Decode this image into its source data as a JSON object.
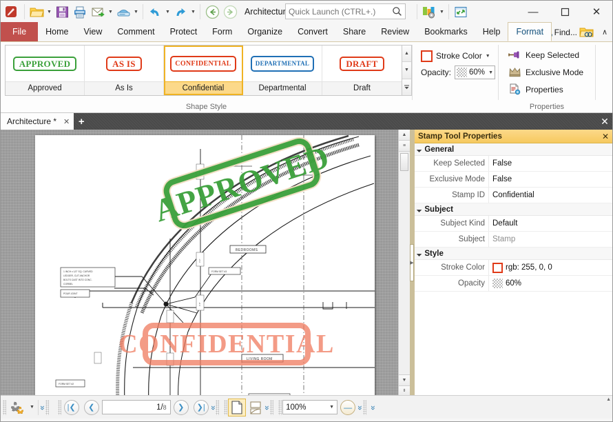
{
  "window": {
    "title": "Architecture* - PDF-XChan..",
    "minimize_label": "—",
    "maximize_label": "☐",
    "close_label": "✕"
  },
  "quick_access": {
    "items": [
      {
        "name": "app-logo",
        "label": "PDF-XChange Editor"
      },
      {
        "name": "open-button",
        "label": "Open",
        "has_dropdown": true
      },
      {
        "name": "save-button",
        "label": "Save",
        "has_dropdown": false
      },
      {
        "name": "print-button",
        "label": "Print",
        "has_dropdown": false
      },
      {
        "name": "email-button",
        "label": "Email",
        "has_dropdown": true
      },
      {
        "name": "scan-button",
        "label": "Scan",
        "has_dropdown": true
      },
      {
        "name": "undo-button",
        "label": "Undo",
        "has_dropdown": true
      },
      {
        "name": "redo-button",
        "label": "Redo",
        "has_dropdown": true
      },
      {
        "name": "back-button",
        "label": "Back",
        "has_dropdown": false
      },
      {
        "name": "forward-button",
        "label": "Forward",
        "has_dropdown": false
      }
    ],
    "customize_label": "Customize Quick Access Toolbar",
    "fullscreen_label": "Full Screen"
  },
  "search": {
    "placeholder": "Quick Launch (CTRL+.)",
    "value": "",
    "icon": "search-icon"
  },
  "ribbon": {
    "tabs": [
      {
        "label": "File",
        "kind": "file"
      },
      {
        "label": "Home"
      },
      {
        "label": "View"
      },
      {
        "label": "Comment"
      },
      {
        "label": "Protect"
      },
      {
        "label": "Form"
      },
      {
        "label": "Organize"
      },
      {
        "label": "Convert"
      },
      {
        "label": "Share"
      },
      {
        "label": "Review"
      },
      {
        "label": "Bookmarks"
      },
      {
        "label": "Help"
      },
      {
        "label": "Format",
        "active": true
      }
    ],
    "find_label": "Find...",
    "collapse_label": "∧"
  },
  "shape_style": {
    "group_label": "Shape Style",
    "items": [
      {
        "caption": "Approved",
        "stamp_text": "APPROVED",
        "color": "#3aa03a",
        "selected": false
      },
      {
        "caption": "As Is",
        "stamp_text": "AS IS",
        "color": "#e03a18",
        "selected": false
      },
      {
        "caption": "Confidential",
        "stamp_text": "CONFIDENTIAL",
        "color": "#e03a18",
        "selected": true
      },
      {
        "caption": "Departmental",
        "stamp_text": "DEPARTMENTAL",
        "color": "#1f6fb5",
        "selected": false
      },
      {
        "caption": "Draft",
        "stamp_text": "DRAFT",
        "color": "#e03a18",
        "selected": false
      }
    ],
    "scroll_up_label": "▲",
    "scroll_down_label": "▼",
    "more_label": "▼"
  },
  "stroke_group": {
    "stroke_color_label": "Stroke Color",
    "stroke_color_hex": "#ff0000",
    "opacity_label": "Opacity:",
    "opacity_value": "60%"
  },
  "properties_group": {
    "group_label": "Properties",
    "items": [
      {
        "label": "Keep Selected",
        "icon": "pin-icon"
      },
      {
        "label": "Exclusive Mode",
        "icon": "crown-icon"
      },
      {
        "label": "Properties",
        "icon": "properties-icon"
      }
    ]
  },
  "doc_tabs": {
    "tabs": [
      {
        "label": "Architecture *",
        "close": "✕"
      }
    ],
    "new_tab_label": "+",
    "close_all_label": "✕"
  },
  "stamp_panel": {
    "title": "Stamp Tool Properties",
    "close_label": "✕",
    "sections": [
      {
        "name": "General",
        "rows": [
          {
            "key": "Keep Selected",
            "value": "False",
            "dim": false
          },
          {
            "key": "Exclusive Mode",
            "value": "False",
            "dim": false
          },
          {
            "key": "Stamp ID",
            "value": "Confidential",
            "dim": false
          }
        ]
      },
      {
        "name": "Subject",
        "rows": [
          {
            "key": "Subject Kind",
            "value": "Default",
            "dim": false
          },
          {
            "key": "Subject",
            "value": "Stamp",
            "dim": true
          }
        ]
      },
      {
        "name": "Style",
        "rows": [
          {
            "key": "Stroke Color",
            "value": "rgb: 255, 0, 0",
            "swatch": "#ff0000",
            "dim": false
          },
          {
            "key": "Opacity",
            "value": "60%",
            "checker": true,
            "dim": false
          }
        ]
      }
    ]
  },
  "document": {
    "stamps": [
      {
        "text": "APPROVED",
        "color": "#3aa03a",
        "rotation": -18
      },
      {
        "text": "CONFIDENTIAL",
        "color": "#f07a5e",
        "rotation": 0
      }
    ],
    "labels": [
      "BEDROOMS",
      "LIVING ROOM",
      "FORM SET #3",
      "POUR JOINT"
    ]
  },
  "statusbar": {
    "tools_label": "Tools",
    "first_page_label": "❰❰",
    "prev_page_label": "❰",
    "next_page_label": "❯",
    "last_page_label": "❯|",
    "page_current": "1",
    "page_sep": "/",
    "page_total": "8",
    "zoom_value": "100%",
    "zoom_out_label": "—",
    "page_view_label": "Single Page View",
    "scroll_mode_label": "Continuous Scroll",
    "expand_label": "»"
  }
}
